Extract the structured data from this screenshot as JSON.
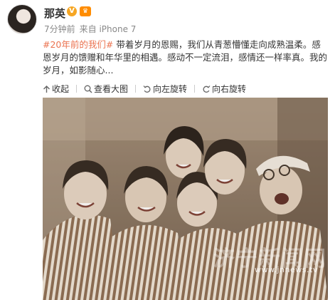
{
  "post": {
    "author": "那英",
    "verified_badge": "V",
    "vip_badge": "♛",
    "time_ago": "7分钟前",
    "source": "来自 iPhone 7",
    "hashtag": "#20年前的我们#",
    "text": " 带着岁月的恩赐，我们从青葱懵懂走向成熟温柔。感恩岁月的馈赠和年华里的相遇。感动不一定流泪，感情还一样率真。我的岁月，如影随心..."
  },
  "actions": [
    {
      "label": "收起",
      "icon": "collapse-arrow-icon"
    },
    {
      "label": "查看大图",
      "icon": "magnifier-icon"
    },
    {
      "label": "向左旋转",
      "icon": "rotate-left-icon"
    },
    {
      "label": "向右旋转",
      "icon": "rotate-right-icon"
    }
  ],
  "watermark": {
    "site": "www.jnnews.tv",
    "name": "济宁新闻网"
  },
  "colors": {
    "hashtag": "#eb7350",
    "text": "#333333",
    "meta": "#888888",
    "photo_tone": "#8a7560"
  }
}
